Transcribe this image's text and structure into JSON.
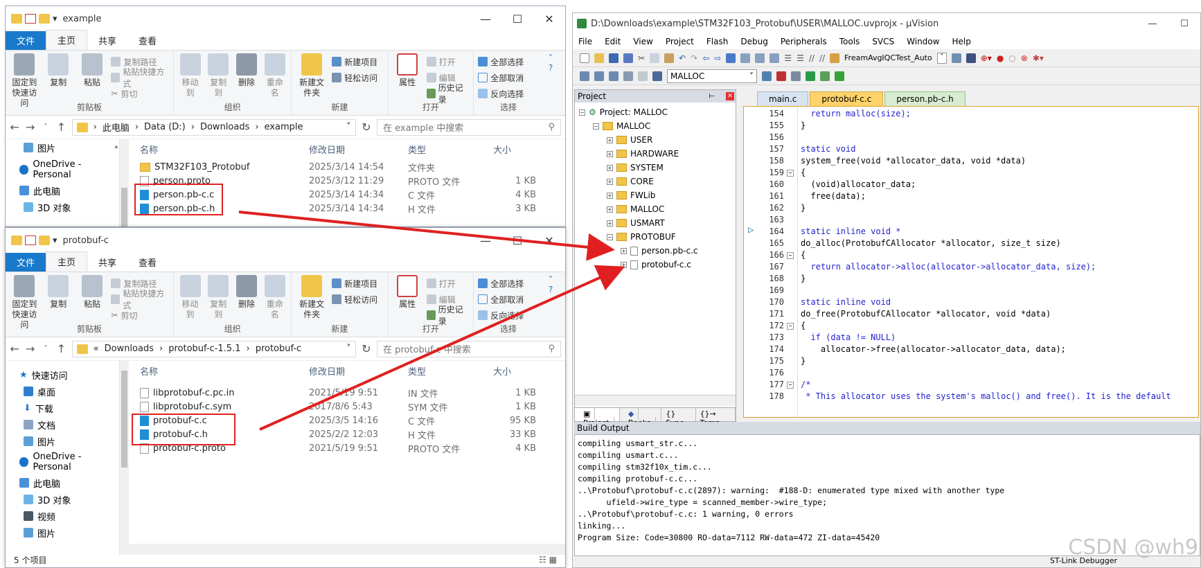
{
  "explorer1": {
    "title": "example",
    "tabs": [
      "文件",
      "主页",
      "共享",
      "查看"
    ],
    "ribbon": {
      "pin": "固定到快速访问",
      "copy": "复制",
      "paste": "粘贴",
      "copy_path": "复制路径",
      "paste_shortcut": "粘贴快捷方式",
      "cut": "剪切",
      "clipboard": "剪贴板",
      "move_to": "移动到",
      "copy_to": "复制到",
      "delete": "删除",
      "rename": "重命名",
      "organize": "组织",
      "new_folder": "新建文件夹",
      "new_item": "新建项目",
      "easy_access": "轻松访问",
      "new": "新建",
      "properties": "属性",
      "open": "打开",
      "edit": "编辑",
      "history": "历史记录",
      "open_group": "打开",
      "select_all": "全部选择",
      "select_none": "全部取消",
      "invert": "反向选择",
      "select": "选择"
    },
    "address": [
      "此电脑",
      "Data (D:)",
      "Downloads",
      "example"
    ],
    "search": "在 example 中搜索",
    "nav": [
      "图片",
      "OneDrive - Personal",
      "此电脑",
      "3D 对象"
    ],
    "headers": [
      "名称",
      "修改日期",
      "类型",
      "大小"
    ],
    "files": [
      {
        "name": "STM32F103_Protobuf",
        "date": "2025/3/14 14:54",
        "type": "文件夹",
        "size": ""
      },
      {
        "name": "person.proto",
        "date": "2025/3/12 11:29",
        "type": "PROTO 文件",
        "size": "1 KB"
      },
      {
        "name": "person.pb-c.c",
        "date": "2025/3/14 14:34",
        "type": "C 文件",
        "size": "4 KB"
      },
      {
        "name": "person.pb-c.h",
        "date": "2025/3/14 14:34",
        "type": "H 文件",
        "size": "3 KB"
      }
    ]
  },
  "explorer2": {
    "title": "protobuf-c",
    "tabs": [
      "文件",
      "主页",
      "共享",
      "查看"
    ],
    "address": [
      "«",
      "Downloads",
      "protobuf-c-1.5.1",
      "protobuf-c"
    ],
    "search": "在 protobuf-c 中搜索",
    "nav": [
      "快速访问",
      "桌面",
      "下载",
      "文档",
      "图片",
      "OneDrive - Personal",
      "此电脑",
      "3D 对象",
      "视频",
      "图片"
    ],
    "headers": [
      "名称",
      "修改日期",
      "类型",
      "大小"
    ],
    "files": [
      {
        "name": "libprotobuf-c.pc.in",
        "date": "2021/5/19 9:51",
        "type": "IN 文件",
        "size": "1 KB"
      },
      {
        "name": "libprotobuf-c.sym",
        "date": "2017/8/6 5:43",
        "type": "SYM 文件",
        "size": "1 KB"
      },
      {
        "name": "protobuf-c.c",
        "date": "2025/3/5 14:16",
        "type": "C 文件",
        "size": "95 KB"
      },
      {
        "name": "protobuf-c.h",
        "date": "2025/2/2 12:03",
        "type": "H 文件",
        "size": "33 KB"
      },
      {
        "name": "protobuf-c.proto",
        "date": "2021/5/19 9:51",
        "type": "PROTO 文件",
        "size": "4 KB"
      }
    ],
    "status": "5 个项目"
  },
  "uv": {
    "title": "D:\\Downloads\\example\\STM32F103_Protobuf\\USER\\MALLOC.uvprojx - µVision",
    "menu": [
      "File",
      "Edit",
      "View",
      "Project",
      "Flash",
      "Debug",
      "Peripherals",
      "Tools",
      "SVCS",
      "Window",
      "Help"
    ],
    "target_combo": "FreamAvgIQCTest_Auto",
    "target2": "MALLOC",
    "project_header": "Project",
    "tree": {
      "root": "Project: MALLOC",
      "target": "MALLOC",
      "groups": [
        "USER",
        "HARDWARE",
        "SYSTEM",
        "CORE",
        "FWLib",
        "MALLOC",
        "USMART",
        "PROTOBUF"
      ],
      "files": [
        "person.pb-c.c",
        "protobuf-c.c"
      ]
    },
    "pane_tabs": [
      "Project",
      "Books",
      "{} Func...",
      "{}→ Temp..."
    ],
    "editor_tabs": [
      "main.c",
      "protobuf-c.c",
      "person.pb-c.h"
    ],
    "code": [
      {
        "n": "154",
        "t": "  return malloc(size);"
      },
      {
        "n": "155",
        "t": "}"
      },
      {
        "n": "156",
        "t": ""
      },
      {
        "n": "157",
        "t": "static void"
      },
      {
        "n": "158",
        "t": "system_free(void *allocator_data, void *data)"
      },
      {
        "n": "159",
        "t": "{"
      },
      {
        "n": "160",
        "t": "  (void)allocator_data;"
      },
      {
        "n": "161",
        "t": "  free(data);"
      },
      {
        "n": "162",
        "t": "}"
      },
      {
        "n": "163",
        "t": ""
      },
      {
        "n": "164",
        "t": "static inline void *"
      },
      {
        "n": "165",
        "t": "do_alloc(ProtobufCAllocator *allocator, size_t size)"
      },
      {
        "n": "166",
        "t": "{"
      },
      {
        "n": "167",
        "t": "  return allocator->alloc(allocator->allocator_data, size);"
      },
      {
        "n": "168",
        "t": "}"
      },
      {
        "n": "169",
        "t": ""
      },
      {
        "n": "170",
        "t": "static inline void"
      },
      {
        "n": "171",
        "t": "do_free(ProtobufCAllocator *allocator, void *data)"
      },
      {
        "n": "172",
        "t": "{"
      },
      {
        "n": "173",
        "t": "  if (data != NULL)"
      },
      {
        "n": "174",
        "t": "    allocator->free(allocator->allocator_data, data);"
      },
      {
        "n": "175",
        "t": "}"
      },
      {
        "n": "176",
        "t": ""
      },
      {
        "n": "177",
        "t": "/*"
      },
      {
        "n": "178",
        "t": " * This allocator uses the system's malloc() and free(). It is the default"
      }
    ],
    "build_header": "Build Output",
    "build": [
      "compiling usmart_str.c...",
      "compiling usmart.c...",
      "compiling stm32f10x_tim.c...",
      "compiling protobuf-c.c...",
      "..\\Protobuf\\protobuf-c.c(2897): warning:  #188-D: enumerated type mixed with another type",
      "      ufield->wire_type = scanned_member->wire_type;",
      "..\\Protobuf\\protobuf-c.c: 1 warning, 0 errors",
      "linking...",
      "Program Size: Code=30800 RO-data=7112 RW-data=472 ZI-data=45420"
    ],
    "status": "ST-Link Debugger"
  },
  "watermark": "CSDN @wh9",
  "colors": {
    "annotation": "#e02020",
    "ribbon_file_tab": "#1979ca",
    "editor_tab_active": "#ffd36a"
  }
}
